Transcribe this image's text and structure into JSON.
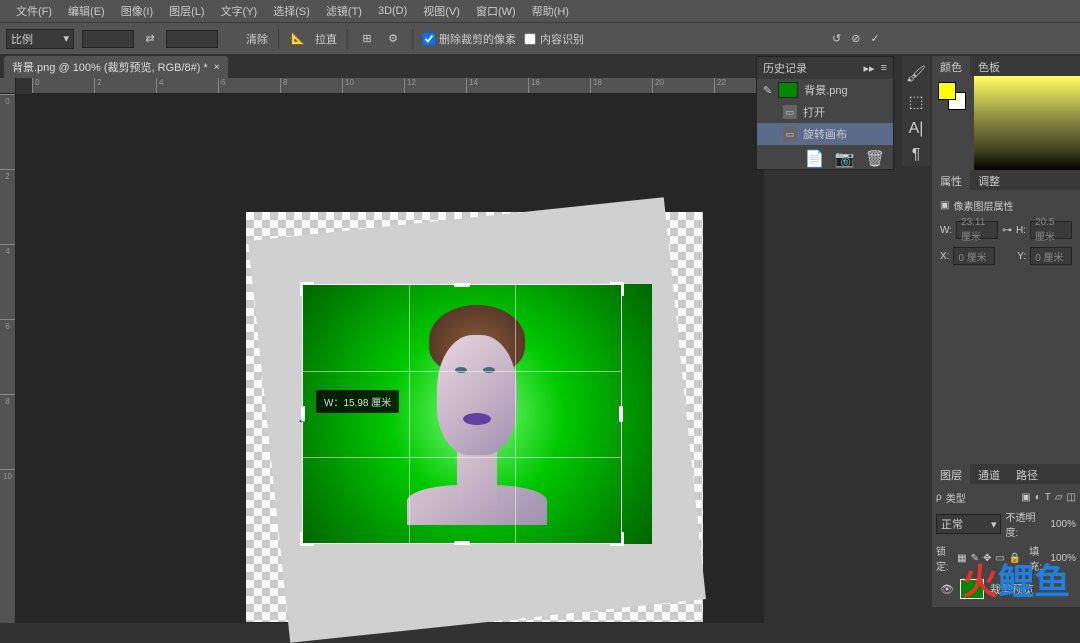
{
  "menubar": [
    "文件(F)",
    "编辑(E)",
    "图像(I)",
    "图层(L)",
    "文字(Y)",
    "选择(S)",
    "滤镜(T)",
    "3D(D)",
    "视图(V)",
    "窗口(W)",
    "帮助(H)"
  ],
  "optbar": {
    "ratio_label": "比例",
    "clear_btn": "清除",
    "straighten": "拉直",
    "delete_cropped": "删除裁剪的像素",
    "content_aware": "内容识别"
  },
  "doctab": {
    "title": "背景.png @ 100% (裁剪预览, RGB/8#) *"
  },
  "ruler_h": [
    "0",
    "2",
    "4",
    "6",
    "8",
    "10",
    "12",
    "14",
    "16",
    "18",
    "20",
    "22"
  ],
  "ruler_v": [
    "0",
    "2",
    "4",
    "6",
    "8",
    "10"
  ],
  "crop_tooltip": "W：15.98 厘米",
  "history": {
    "tab": "历史记录",
    "source": "背景.png",
    "steps": [
      "打开",
      "旋转画布"
    ]
  },
  "color": {
    "tabs": [
      "颜色",
      "色板"
    ]
  },
  "props": {
    "tabs": [
      "属性",
      "调整"
    ],
    "title": "像素图层属性",
    "w_label": "W:",
    "w_val": "23.11 厘米",
    "h_label": "H:",
    "h_val": "20.5 厘米",
    "x_label": "X:",
    "x_val": "0 厘米",
    "y_label": "Y:",
    "y_val": "0 厘米"
  },
  "layers": {
    "tabs": [
      "图层",
      "通道",
      "路径"
    ],
    "type_label": "类型",
    "blend": "正常",
    "opacity_label": "不透明度:",
    "opacity": "100%",
    "lock_label": "锁定:",
    "fill_label": "填充:",
    "fill": "100%",
    "layer_name": "裁剪预览"
  },
  "watermark": "火鲤鱼"
}
